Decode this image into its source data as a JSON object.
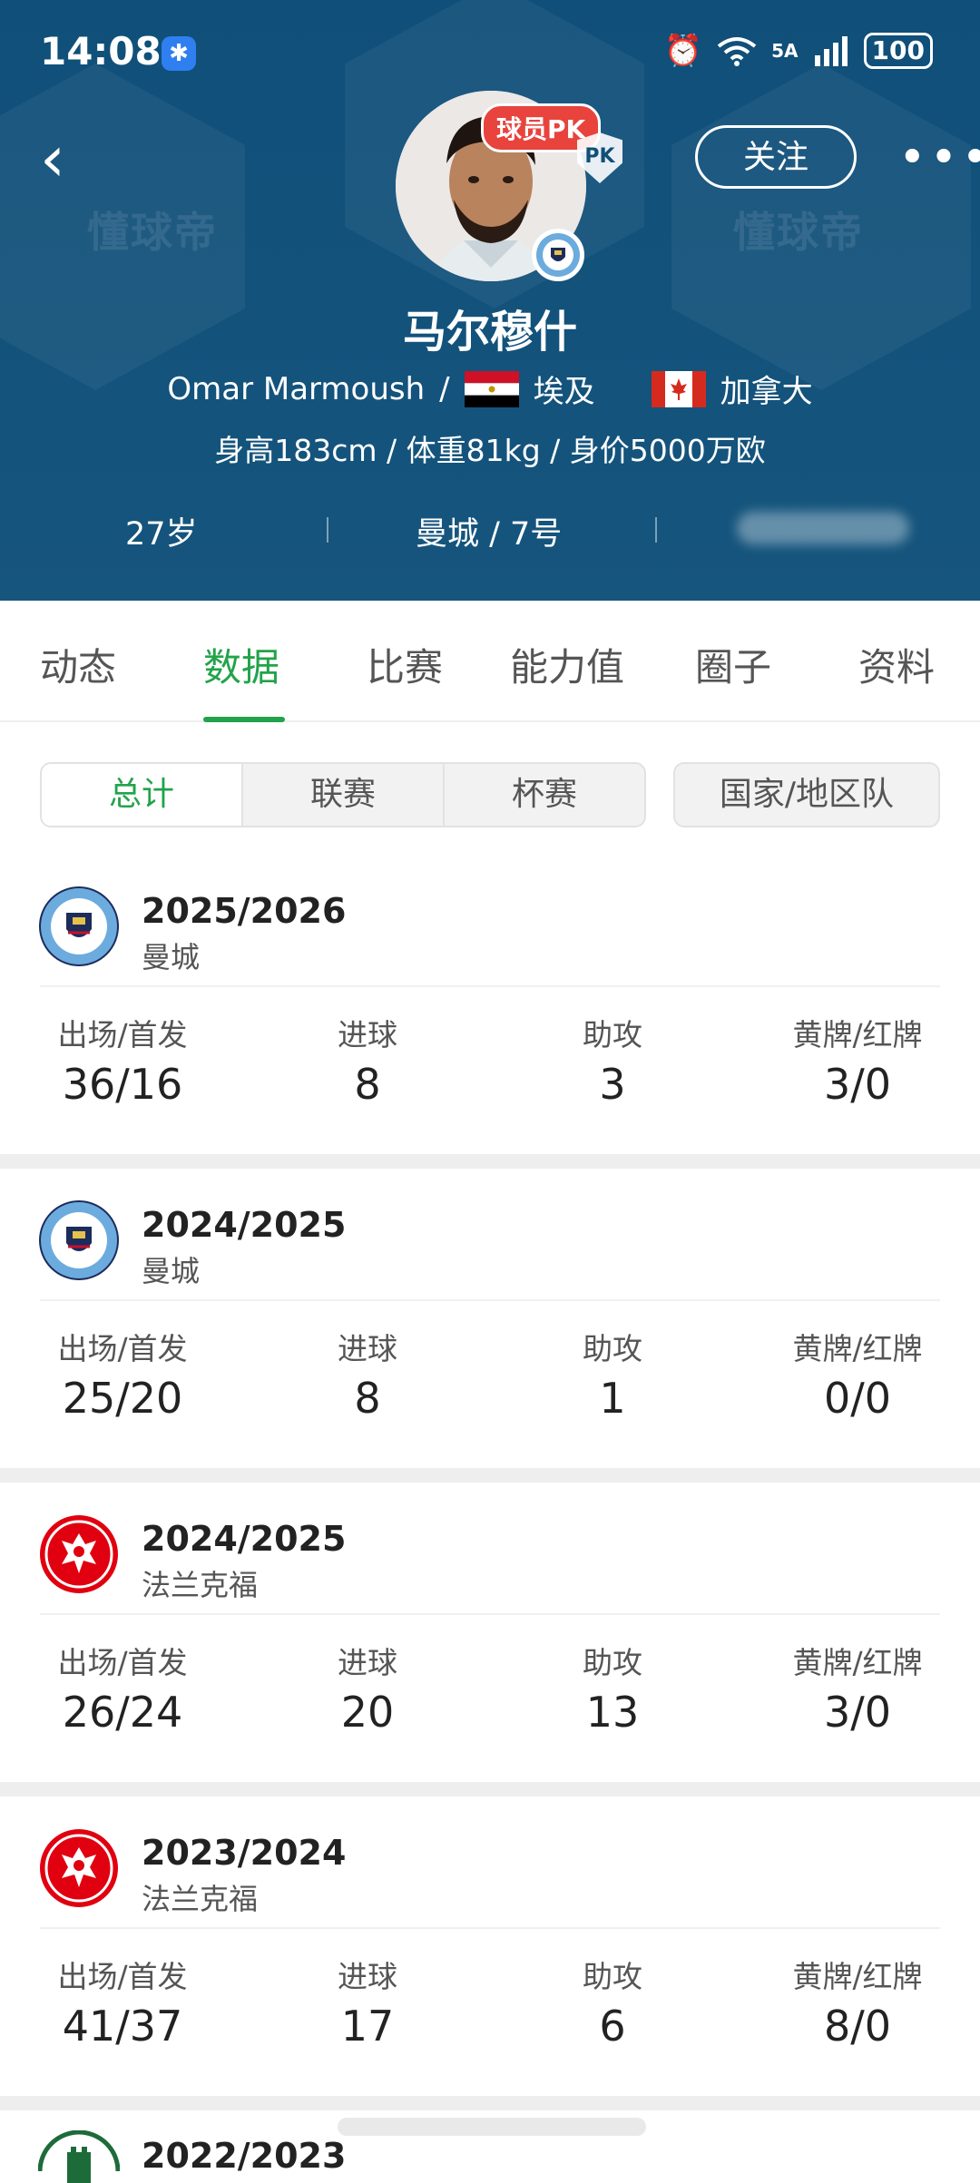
{
  "status_bar": {
    "time": "14:08",
    "network": "5A",
    "battery": "100"
  },
  "header": {
    "follow_label": "关注",
    "pk_badge": "球员PK",
    "pk_shield": "PK",
    "name_cn": "马尔穆什",
    "name_en": "Omar Marmoush",
    "slash": "/",
    "nationality_1": "埃及",
    "nationality_2": "加拿大",
    "info": "身高183cm / 体重81kg / 身价5000万欧",
    "age": "27岁",
    "club_number": "曼城 / 7号",
    "watermark": "懂球帝"
  },
  "tabs": [
    {
      "label": "动态"
    },
    {
      "label": "数据"
    },
    {
      "label": "比赛"
    },
    {
      "label": "能力值"
    },
    {
      "label": "圈子"
    },
    {
      "label": "资料"
    }
  ],
  "segment": [
    {
      "label": "总计"
    },
    {
      "label": "联赛"
    },
    {
      "label": "杯赛"
    }
  ],
  "nation_label": "国家/地区队",
  "stat_labels": {
    "apps": "出场/首发",
    "goals": "进球",
    "assists": "助攻",
    "cards": "黄牌/红牌"
  },
  "seasons": [
    {
      "season": "2025/2026",
      "club": "曼城",
      "apps": "36/16",
      "goals": "8",
      "assists": "3",
      "cards": "3/0"
    },
    {
      "season": "2024/2025",
      "club": "曼城",
      "apps": "25/20",
      "goals": "8",
      "assists": "1",
      "cards": "0/0"
    },
    {
      "season": "2024/2025",
      "club": "法兰克福",
      "apps": "26/24",
      "goals": "20",
      "assists": "13",
      "cards": "3/0"
    },
    {
      "season": "2023/2024",
      "club": "法兰克福",
      "apps": "41/37",
      "goals": "17",
      "assists": "6",
      "cards": "8/0"
    },
    {
      "season": "2022/2023"
    }
  ],
  "colors": {
    "header_bg": "#0f4f79",
    "accent_green": "#22a34b",
    "city_blue": "#6cabdd",
    "frankfurt_red": "#e1000f"
  }
}
